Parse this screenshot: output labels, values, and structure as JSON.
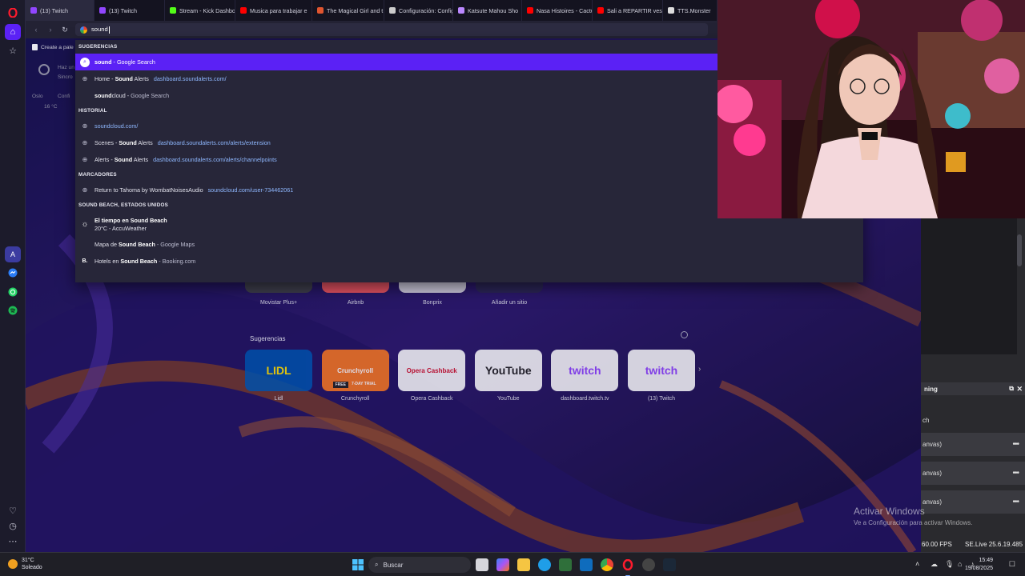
{
  "browser": {
    "tabs": [
      {
        "label": "(13) Twitch",
        "color": "#9146ff",
        "active": true
      },
      {
        "label": "(13) Twitch",
        "color": "#9146ff",
        "active": false
      },
      {
        "label": "Stream - Kick Dashbo",
        "color": "#53fc18",
        "active": false
      },
      {
        "label": "Musica para trabajar e",
        "color": "#ff0000",
        "active": false
      },
      {
        "label": "The Magical Girl and t",
        "color": "#e0552f",
        "active": false
      },
      {
        "label": "Configuración: Config",
        "color": "#cccccc",
        "active": false
      },
      {
        "label": "Katsute Mahou Sho",
        "color": "#bb88ff",
        "active": false
      },
      {
        "label": "Nasa Histoires - Cactu",
        "color": "#ff0000",
        "active": false
      },
      {
        "label": "Sali a REPARTIR vestid",
        "color": "#ff0000",
        "active": false
      },
      {
        "label": "TTS.Monster",
        "color": "#dddddd",
        "active": false
      }
    ],
    "omnibox_value": "sound",
    "bookmark_label": "Create a pale",
    "behind": {
      "hint1": "Haz un",
      "hint2": "Sincro",
      "city": "Oslo",
      "temp": "16 °C",
      "config": "Confi"
    }
  },
  "dropdown": {
    "sections": {
      "suggestions": "SUGERENCIAS",
      "history": "HISTORIAL",
      "bookmarks": "MARCADORES",
      "location": "SOUND BEACH, ESTADOS UNIDOS"
    },
    "suggestion_rows": [
      {
        "pre": "",
        "bold": "sound",
        "post": " - ",
        "dim": "Google Search",
        "url": "",
        "selected": true
      },
      {
        "pre": "Home - ",
        "bold": "Sound",
        "post": " Alerts",
        "dim": "",
        "url": "dashboard.soundalerts.com/",
        "selected": false
      },
      {
        "pre": "",
        "bold": "sound",
        "post": "cloud - ",
        "dim": "Google Search",
        "url": "",
        "selected": false
      }
    ],
    "history_rows": [
      {
        "pre": "",
        "bold": "",
        "post": "",
        "url": "soundcloud.com/"
      },
      {
        "pre": "Scenes - ",
        "bold": "Sound",
        "post": " Alerts",
        "url": "dashboard.soundalerts.com/alerts/extension"
      },
      {
        "pre": "Alerts - ",
        "bold": "Sound",
        "post": " Alerts",
        "url": "dashboard.soundalerts.com/alerts/channelpoints"
      }
    ],
    "bookmark_rows": [
      {
        "pre": "Return to Tahoma by WombatNoisesAudio",
        "url": "soundcloud.com/user-734462061"
      }
    ],
    "weather_row": {
      "title_pre": "El tiempo en ",
      "title_bold": "Sound Beach",
      "subtitle": "20°C - AccuWeather"
    },
    "maps_row": {
      "pre": "Mapa de ",
      "bold": "Sound Beach",
      "dim": " - Google Maps"
    },
    "hotels_row": {
      "pre": "Hotels en ",
      "bold": "Sound Beach",
      "dim": " - Booking.com"
    }
  },
  "speed_dial": {
    "top_labels": [
      "Movistar Plus+",
      "Airbnb",
      "Bonprix",
      "Añadir un sitio"
    ],
    "heading": "Sugerencias",
    "tiles": [
      {
        "label": "Lidl",
        "text": "LIDL",
        "bg": "#0050aa",
        "fg": "#ffe000"
      },
      {
        "label": "Crunchyroll",
        "text": "Crunchyroll",
        "bg": "#f47521",
        "fg": "#ffffff"
      },
      {
        "label": "Opera Cashback",
        "text": "Opera Cashback",
        "bg": "#f4f4f6",
        "fg": "#d0102a"
      },
      {
        "label": "YouTube",
        "text": "YouTube",
        "bg": "#f4f4f6",
        "fg": "#222222"
      },
      {
        "label": "dashboard.twitch.tv",
        "text": "twitch",
        "bg": "#f4f4f6",
        "fg": "#9146ff"
      },
      {
        "label": "(13) Twitch",
        "text": "twitch",
        "bg": "#f4f4f6",
        "fg": "#9146ff"
      }
    ],
    "crunchy_badge": "FREE",
    "crunchy_trial": "7-DAY TRIAL"
  },
  "obs": {
    "header": "ning",
    "rows": [
      "ch",
      "anvas)",
      "anvas)",
      "anvas)"
    ],
    "fps": "60.00 FPS",
    "version": "SE.Live 25.6.19.485"
  },
  "watermark": {
    "line1": "Activar Windows",
    "line2": "Ve a Configuración para activar Windows."
  },
  "taskbar": {
    "temp": "31°C",
    "condition": "Soleado",
    "search": "Buscar",
    "time": "15:49",
    "date": "19/08/2025"
  },
  "colors": {
    "accent": "#5b21f5",
    "opera_red": "#ff1b2d"
  }
}
